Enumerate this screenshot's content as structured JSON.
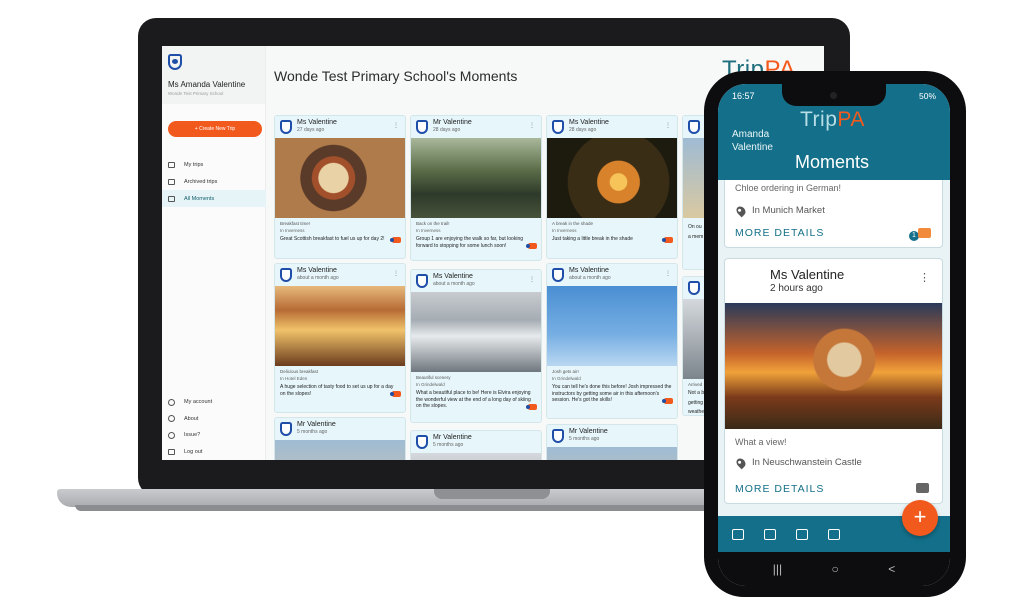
{
  "sidebar": {
    "user_name": "Ms Amanda Valentine",
    "school": "Wonde Test Primary School",
    "create_label": "+   Create New Trip",
    "nav": [
      {
        "label": "My trips",
        "icon": "briefcase-icon"
      },
      {
        "label": "Archived trips",
        "icon": "archive-icon"
      },
      {
        "label": "All Moments",
        "icon": "moments-icon"
      }
    ],
    "bottom": [
      {
        "label": "My account",
        "icon": "person-icon"
      },
      {
        "label": "About",
        "icon": "info-icon"
      },
      {
        "label": "Issue?",
        "icon": "help-icon"
      },
      {
        "label": "Log out",
        "icon": "logout-icon"
      }
    ]
  },
  "main": {
    "title": "Wonde Test Primary School's Moments",
    "brand": {
      "part1": "Trip",
      "part2": "PA"
    }
  },
  "cards": [
    {
      "name": "Ms Valentine",
      "time": "27 days ago",
      "caption": "Breakfast time!",
      "location": "In Inverness",
      "text": "Great Scottish breakfast to fuel us up for day 2!",
      "image": "food"
    },
    {
      "name": "Mr Valentine",
      "time": "28 days ago",
      "caption": "Back on the trail!",
      "location": "In Inverness",
      "text": "Group 1 are enjoying the walk so far, but looking forward to stopping for some lunch soon!",
      "image": "hike"
    },
    {
      "name": "Ms Valentine",
      "time": "28 days ago",
      "caption": "A break in the shade",
      "location": "In Inverness",
      "text": "Just taking a little break in the shade",
      "image": "forest"
    },
    {
      "name": "Ms Valentine",
      "time": "about a month ago",
      "caption": "Delicious breakfast",
      "location": "In Hotel Eden",
      "text": "A huge selection of tasty food to set us up for a day on the slopes!",
      "image": "buffet"
    },
    {
      "name": "Ms Valentine",
      "time": "about a month ago",
      "caption": "Beautiful scenery",
      "location": "In Grindelwald",
      "text": "What a beautiful place to be! Here is Elvira enjoying the wonderful view at the end of a long day of skiing on the slopes.",
      "image": "mount"
    },
    {
      "name": "Ms Valentine",
      "time": "about a month ago",
      "caption": "Josh gets air!",
      "location": "In Grindelwald",
      "text": "You can tell he's done this before! Josh impressed the instructors by getting some air in this afternoon's session. He's got the skills!",
      "image": "ski"
    },
    {
      "name": "Mr Valentine",
      "time": "5 months ago",
      "image": "beach"
    },
    {
      "name": "Mr Valentine",
      "time": "5 months ago",
      "image": "town"
    },
    {
      "name": "Mr Valentine",
      "time": "5 months ago",
      "image": "beach"
    }
  ],
  "cut_card": {
    "lines": [
      "On ou",
      "a mem",
      "Arrived",
      "Not a b",
      "getting",
      "weathe"
    ]
  },
  "phone": {
    "time": "16:57",
    "battery": "50%",
    "user": [
      "Amanda",
      "Valentine"
    ],
    "brand": {
      "part1": "Trip",
      "part2": "PA"
    },
    "title": "Moments",
    "card1": {
      "caption": "Chloe ordering in German!",
      "location": "In Munich Market",
      "more": "MORE DETAILS",
      "likes": "1"
    },
    "card2": {
      "name": "Ms Valentine",
      "time": "2 hours ago",
      "caption": "What a view!",
      "location": "In Neuschwanstein Castle",
      "more": "MORE DETAILS"
    },
    "fab": "+",
    "nav_icons": [
      "briefcase-icon",
      "calendar-icon",
      "moments-icon",
      "archive-icon"
    ],
    "system_nav": [
      "|||",
      "○",
      "<"
    ]
  },
  "colors": {
    "teal": "#14708a",
    "orange": "#f25a1d",
    "card_bg": "#e6f6fb"
  }
}
